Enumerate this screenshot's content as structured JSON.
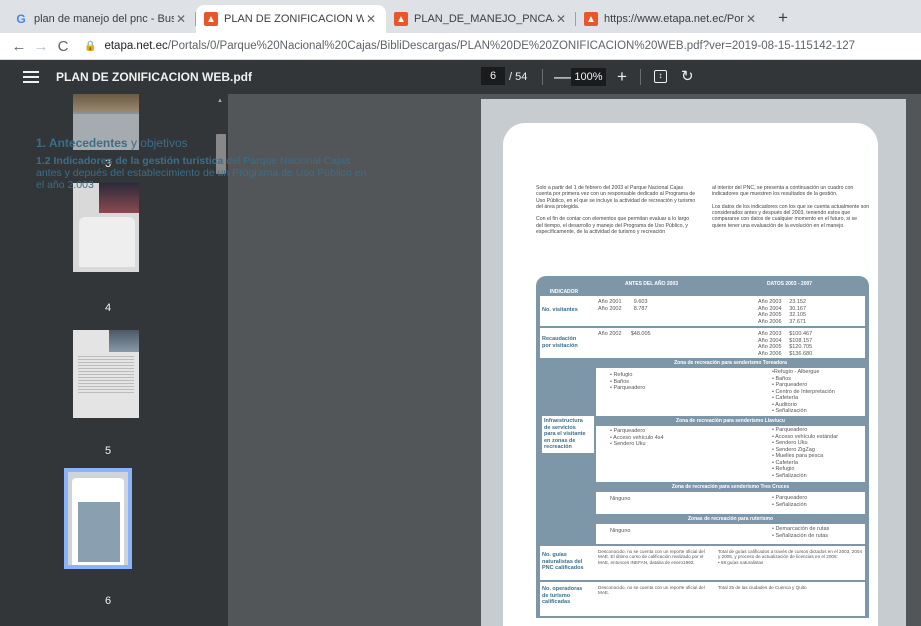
{
  "tabs": [
    {
      "title": "plan de manejo del pnc - Buscar",
      "icon": "google-icon",
      "active": false
    },
    {
      "title": "PLAN DE ZONIFICACION WEB.pc",
      "icon": "etapa-icon",
      "active": true
    },
    {
      "title": "PLAN_DE_MANEJO_PNCAJAS.pc",
      "icon": "etapa-icon",
      "active": false
    },
    {
      "title": "https://www.etapa.net.ec/Portals",
      "icon": "etapa-icon",
      "active": false
    }
  ],
  "address": {
    "host": "etapa.net.ec",
    "path": "/Portals/0/Parque%20Nacional%20Cajas/BibliDescargas/PLAN%20DE%20ZONIFICACION%20WEB.pdf?ver=2019-08-15-115142-127"
  },
  "pdf": {
    "title": "PLAN DE ZONIFICACION WEB.pdf",
    "current_page": "6",
    "total_pages": "/ 54",
    "zoom": "100%"
  },
  "thumbnails": [
    "3",
    "4",
    "5",
    "6"
  ],
  "content": {
    "heading_a": "1. Antecedentes",
    "heading_b": "y objetivos",
    "sub_bold": "1.2 Indicadores de la gestión turística",
    "sub_rest": "del Parque Nacional Cajas antes y depués del establecimiento de un Programa de Uso Público en el año 2.003",
    "col1_p1": "Solo a partir del 1 de febrero del 2003 el Parque Nacional Cajas cuenta por primera vez con un responsable dedicado al Programa de Uso Público, en el que se incluye la actividad de recreación y turismo del área protegida.",
    "col1_p2": "Con el fin de contar con elementos que permitan evaluar a lo largo del tiempo, el desarrollo y manejo del Programa de Uso Público, y específicamente, de la actividad de turismo y recreación",
    "col2_p1": "al interior del PNC, se presenta a continuación un cuadro con indicadores que muestren los resultados de la gestión.",
    "col2_p2": "Los datos de los indicadores con los que se cuenta actualmente son considerados antes y después del 2003, teniendo estos que compararse con datos de cualquier momento en el futuro, si se quiere tener una evaluación de la evolución en el manejo."
  },
  "table": {
    "head_indicator": "INDICADOR",
    "head_before": "ANTES DEL AÑO 2003",
    "head_after": "DATOS 2003 - 2007",
    "r1_label": "No. visitantes",
    "r1_before": "Año 2001        9.603\nAño 2002        8.787",
    "r1_after": "Año 2003     23.152\nAño 2004     30.167\nAño 2005     32.105\nAño 2006     37.671",
    "r2_label": "Recaudación\npor visitación",
    "r2_before": "Año 2002      $48.005",
    "r2_after": "Año 2003     $100.467\nAño 2004     $108.157\nAño 2005     $120.705\nAño 2006     $136.680",
    "band1": "Zona de recreación para senderismo Toreadora",
    "z1_before": "• Refugio\n• Baños\n• Parqueadero",
    "z1_after": "•Refugio - Albergue\n• Baños\n• Parqueadero\n• Centro de Interpretación\n• Cafetería\n• Auditorio\n• Señalización",
    "infra_label": "Infraestructura\nde servicios\npara el visitante\nen zonas de\nrecreación",
    "band2": "Zona de recreación para senderismo Llaviucu",
    "z2_before": "• Parqueadero\n• Acceso vehículo 4x4\n• Sendero Uku",
    "z2_after": "• Parqueadero\n• Acceso vehículo estándar\n• Sendero Uku\n• Sendero ZigZag\n• Muelles para pesca\n• Cafetería\n• Refugio\n• Señalización",
    "band3": "Zona de recreación para senderismo Tres Cruces",
    "z3_before": "Ninguno",
    "z3_after": "• Parqueadero\n• Señalización",
    "band4": "Zonas de recreación para ruterismo",
    "z4_before": "Ninguno",
    "z4_after": "• Demarcación de rutas\n• Señalización de rutas",
    "r5_label": "No. guías\nnaturalistas del\nPNC calificados",
    "r5_before": "Desconocido, no se cuenta con un reporte oficial del MAE. El último curso de calificación realizado por el MAE, entonces INEFAN, databa de enero1992.",
    "r5_after": "Total de guías calificados a través de cursos dictados en el 2003, 2004 y 2005, y proceso de actualización de licencias en el 2006:\n• 58 guías naturalistas",
    "r6_label": "No. operadoras\nde turismo\ncalificadas",
    "r6_before": "Desconocido, no se cuenta con un reporte oficial del MAE.",
    "r6_after": "Total 25 de las ciudades de Cuenca y Quito"
  }
}
